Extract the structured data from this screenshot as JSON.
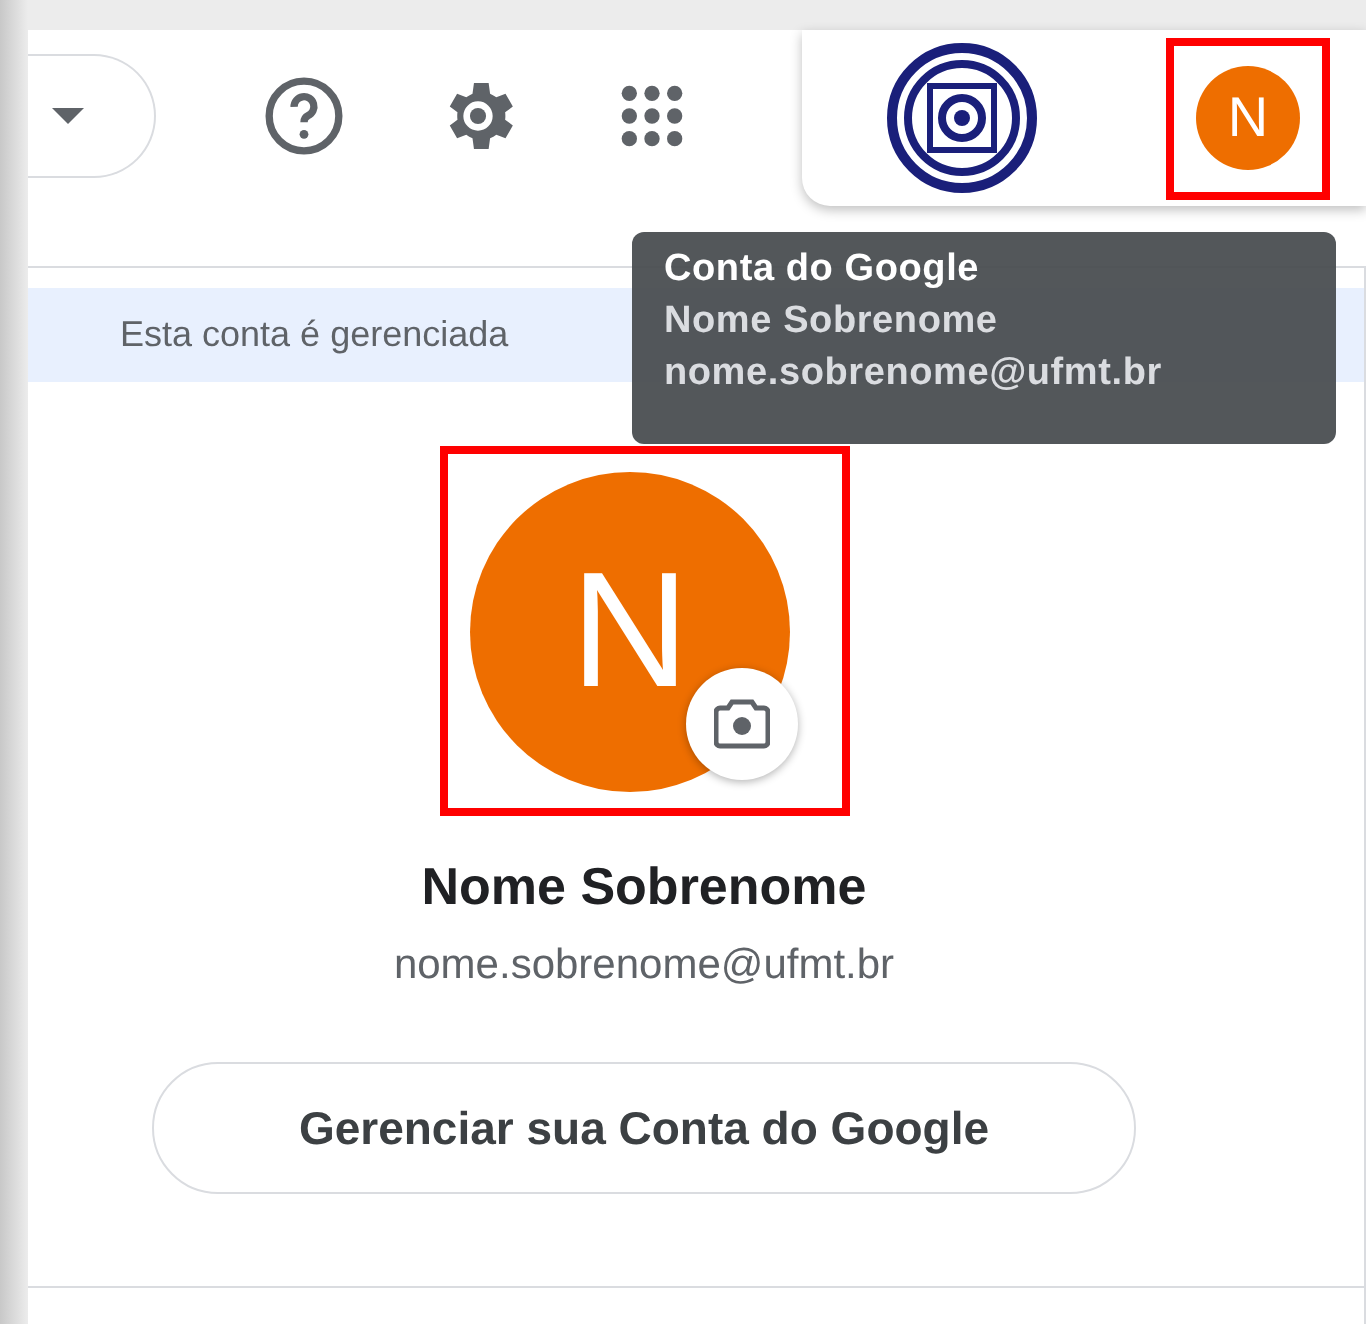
{
  "toolbar": {
    "icons": [
      {
        "kind": "dropdown"
      },
      {
        "kind": "help"
      },
      {
        "kind": "settings"
      },
      {
        "kind": "apps"
      }
    ]
  },
  "account_chip": {
    "avatar_letter": "N",
    "highlighted": true
  },
  "tooltip": {
    "title": "Conta do Google",
    "name": "Nome Sobrenome",
    "email": "nome.sobrenome@ufmt.br"
  },
  "banner": {
    "text": "Esta conta é gerenciada"
  },
  "profile": {
    "avatar_letter": "N",
    "highlighted": true,
    "name": "Nome Sobrenome",
    "email": "nome.sobrenome@ufmt.br",
    "manage_button": "Gerenciar sua Conta do Google"
  }
}
